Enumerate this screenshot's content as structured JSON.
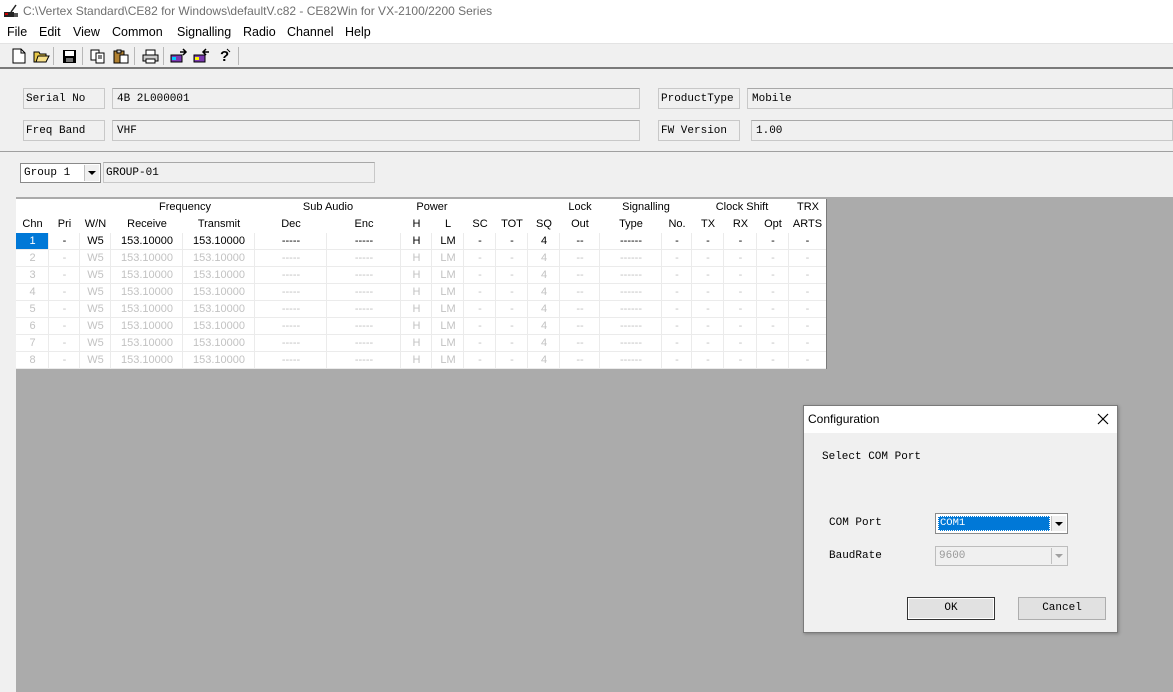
{
  "window": {
    "title": "C:\\Vertex Standard\\CE82 for Windows\\defaultV.c82 - CE82Win for VX-2100/2200 Series"
  },
  "menu": [
    "File",
    "Edit",
    "View",
    "Common",
    "Signalling",
    "Radio",
    "Channel",
    "Help"
  ],
  "toolbar": {
    "buttons": [
      "new-icon",
      "open-icon",
      "save-icon",
      "copy-icon",
      "paste-icon",
      "print-icon",
      "read-radio-icon",
      "write-radio-icon",
      "help-icon"
    ]
  },
  "info": {
    "serial_label": "Serial No",
    "serial_value": "4B 2L000001",
    "band_label": "Freq Band",
    "band_value": "VHF",
    "product_label": "ProductType",
    "product_value": "Mobile",
    "fw_label": "FW Version",
    "fw_value": "1.00"
  },
  "group": {
    "selected": "Group 1",
    "name": "GROUP-01"
  },
  "grid": {
    "group_headers": {
      "frequency": "Frequency",
      "sub_audio": "Sub Audio",
      "power": "Power",
      "lock": "Lock",
      "signalling": "Signalling",
      "clock_shift": "Clock Shift",
      "trx": "TRX"
    },
    "columns": [
      "Chn",
      "Pri",
      "W/N",
      "Receive",
      "Transmit",
      "Dec",
      "Enc",
      "H",
      "L",
      "SC",
      "TOT",
      "SQ",
      "Out",
      "Type",
      "No.",
      "TX",
      "RX",
      "Opt",
      "ARTS"
    ],
    "rows": [
      {
        "chn": "1",
        "pri": "-",
        "wn": "W5",
        "rx": "153.10000",
        "tx": "153.10000",
        "dec": "-----",
        "enc": "-----",
        "h": "H",
        "l": "LM",
        "sc": "-",
        "tot": "-",
        "sq": "4",
        "out": "--",
        "type": "------",
        "no": "-",
        "cs_tx": "-",
        "cs_rx": "-",
        "opt": "-",
        "arts": "-"
      },
      {
        "chn": "2",
        "pri": "-",
        "wn": "W5",
        "rx": "153.10000",
        "tx": "153.10000",
        "dec": "-----",
        "enc": "-----",
        "h": "H",
        "l": "LM",
        "sc": "-",
        "tot": "-",
        "sq": "4",
        "out": "--",
        "type": "------",
        "no": "-",
        "cs_tx": "-",
        "cs_rx": "-",
        "opt": "-",
        "arts": "-"
      },
      {
        "chn": "3",
        "pri": "-",
        "wn": "W5",
        "rx": "153.10000",
        "tx": "153.10000",
        "dec": "-----",
        "enc": "-----",
        "h": "H",
        "l": "LM",
        "sc": "-",
        "tot": "-",
        "sq": "4",
        "out": "--",
        "type": "------",
        "no": "-",
        "cs_tx": "-",
        "cs_rx": "-",
        "opt": "-",
        "arts": "-"
      },
      {
        "chn": "4",
        "pri": "-",
        "wn": "W5",
        "rx": "153.10000",
        "tx": "153.10000",
        "dec": "-----",
        "enc": "-----",
        "h": "H",
        "l": "LM",
        "sc": "-",
        "tot": "-",
        "sq": "4",
        "out": "--",
        "type": "------",
        "no": "-",
        "cs_tx": "-",
        "cs_rx": "-",
        "opt": "-",
        "arts": "-"
      },
      {
        "chn": "5",
        "pri": "-",
        "wn": "W5",
        "rx": "153.10000",
        "tx": "153.10000",
        "dec": "-----",
        "enc": "-----",
        "h": "H",
        "l": "LM",
        "sc": "-",
        "tot": "-",
        "sq": "4",
        "out": "--",
        "type": "------",
        "no": "-",
        "cs_tx": "-",
        "cs_rx": "-",
        "opt": "-",
        "arts": "-"
      },
      {
        "chn": "6",
        "pri": "-",
        "wn": "W5",
        "rx": "153.10000",
        "tx": "153.10000",
        "dec": "-----",
        "enc": "-----",
        "h": "H",
        "l": "LM",
        "sc": "-",
        "tot": "-",
        "sq": "4",
        "out": "--",
        "type": "------",
        "no": "-",
        "cs_tx": "-",
        "cs_rx": "-",
        "opt": "-",
        "arts": "-"
      },
      {
        "chn": "7",
        "pri": "-",
        "wn": "W5",
        "rx": "153.10000",
        "tx": "153.10000",
        "dec": "-----",
        "enc": "-----",
        "h": "H",
        "l": "LM",
        "sc": "-",
        "tot": "-",
        "sq": "4",
        "out": "--",
        "type": "------",
        "no": "-",
        "cs_tx": "-",
        "cs_rx": "-",
        "opt": "-",
        "arts": "-"
      },
      {
        "chn": "8",
        "pri": "-",
        "wn": "W5",
        "rx": "153.10000",
        "tx": "153.10000",
        "dec": "-----",
        "enc": "-----",
        "h": "H",
        "l": "LM",
        "sc": "-",
        "tot": "-",
        "sq": "4",
        "out": "--",
        "type": "------",
        "no": "-",
        "cs_tx": "-",
        "cs_rx": "-",
        "opt": "-",
        "arts": "-"
      }
    ]
  },
  "dialog": {
    "title": "Configuration",
    "prompt": "Select COM Port",
    "com_label": "COM Port",
    "com_value": "COM1",
    "baud_label": "BaudRate",
    "baud_value": "9600",
    "ok_label": "OK",
    "cancel_label": "Cancel"
  },
  "colors": {
    "selection": "#0078d7",
    "workspace": "#ababab",
    "panel": "#f0f0f0"
  }
}
